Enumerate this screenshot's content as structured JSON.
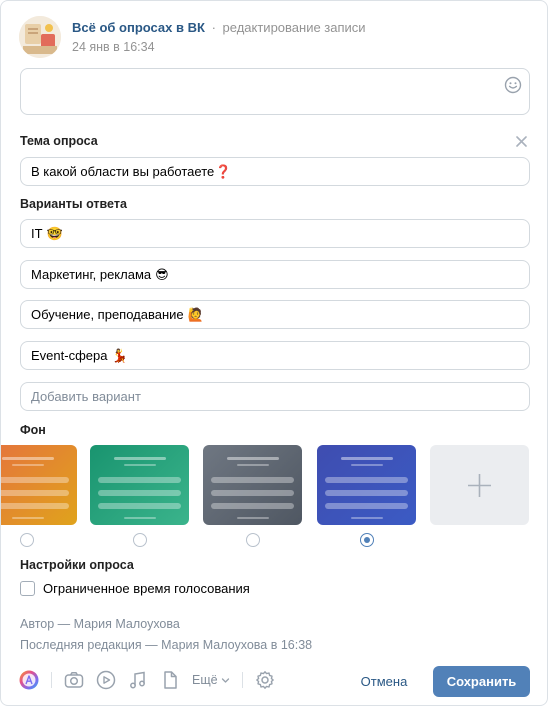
{
  "header": {
    "group_name": "Всё об опросах в ВК",
    "separator": "·",
    "action": "редактирование записи",
    "timestamp": "24 янв в 16:34"
  },
  "poll": {
    "topic_label": "Тема опроса",
    "topic_value": "В какой области вы работаете",
    "topic_emoji": "❓",
    "options_label": "Варианты ответа",
    "options": [
      {
        "text": "IT",
        "emoji": "🤓"
      },
      {
        "text": "Маркетинг, реклама",
        "emoji": "😎"
      },
      {
        "text": "Обучение, преподавание",
        "emoji": "🙋"
      },
      {
        "text": "Event-сфера",
        "emoji": "💃"
      }
    ],
    "add_option_placeholder": "Добавить вариант",
    "background_label": "Фон",
    "backgrounds": [
      {
        "name": "orange",
        "from": "#e5703f",
        "to": "#e0a31c"
      },
      {
        "name": "green",
        "from": "#19946f",
        "to": "#3bb48c"
      },
      {
        "name": "gray",
        "from": "#6f7782",
        "to": "#4f5762"
      },
      {
        "name": "blue",
        "from": "#3f4db0",
        "to": "#3b5bc4"
      }
    ],
    "selected_background": 3,
    "settings_label": "Настройки опроса",
    "limited_time_label": "Ограниченное время голосования"
  },
  "meta": {
    "author": "Автор — Мария Малоухова",
    "last_edit": "Последняя редакция — Мария Малоухова в 16:38"
  },
  "toolbar": {
    "more_label": "Ещё",
    "icons": [
      "palette-icon",
      "camera-icon",
      "video-icon",
      "music-icon",
      "document-icon",
      "settings-icon"
    ]
  },
  "actions": {
    "cancel_label": "Отмена",
    "save_label": "Сохранить"
  },
  "colors": {
    "accent": "#5181b8",
    "link": "#2a5885",
    "muted": "#818c99",
    "border": "#d3d9de"
  }
}
